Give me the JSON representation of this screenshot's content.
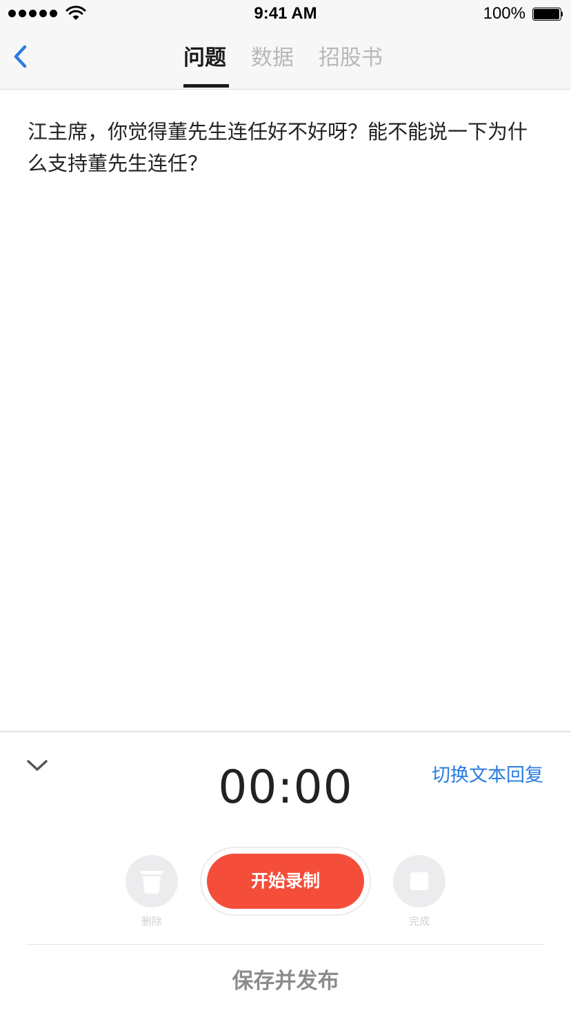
{
  "status_bar": {
    "time": "9:41 AM",
    "battery": "100%",
    "icons": [
      "signal-dots-icon",
      "wifi-icon",
      "battery-icon"
    ]
  },
  "nav": {
    "back_icon": "chevron-left-icon",
    "tabs": [
      {
        "label": "问题",
        "active": true
      },
      {
        "label": "数据",
        "active": false
      },
      {
        "label": "招股书",
        "active": false
      }
    ]
  },
  "question": {
    "text": "江主席，你觉得董先生连任好不好呀？能不能说一下为什么支持董先生连任？"
  },
  "recorder": {
    "collapse_icon": "chevron-down-icon",
    "timer": "00:00",
    "switch_label": "切换文本回复",
    "delete_label": "删除",
    "delete_icon": "trash-icon",
    "record_label": "开始录制",
    "done_label": "完成",
    "done_icon": "stop-icon"
  },
  "footer": {
    "publish_label": "保存并发布"
  },
  "colors": {
    "accent_blue": "#2a7be0",
    "record_red": "#f44e3b",
    "nav_bg": "#f7f7f7"
  }
}
